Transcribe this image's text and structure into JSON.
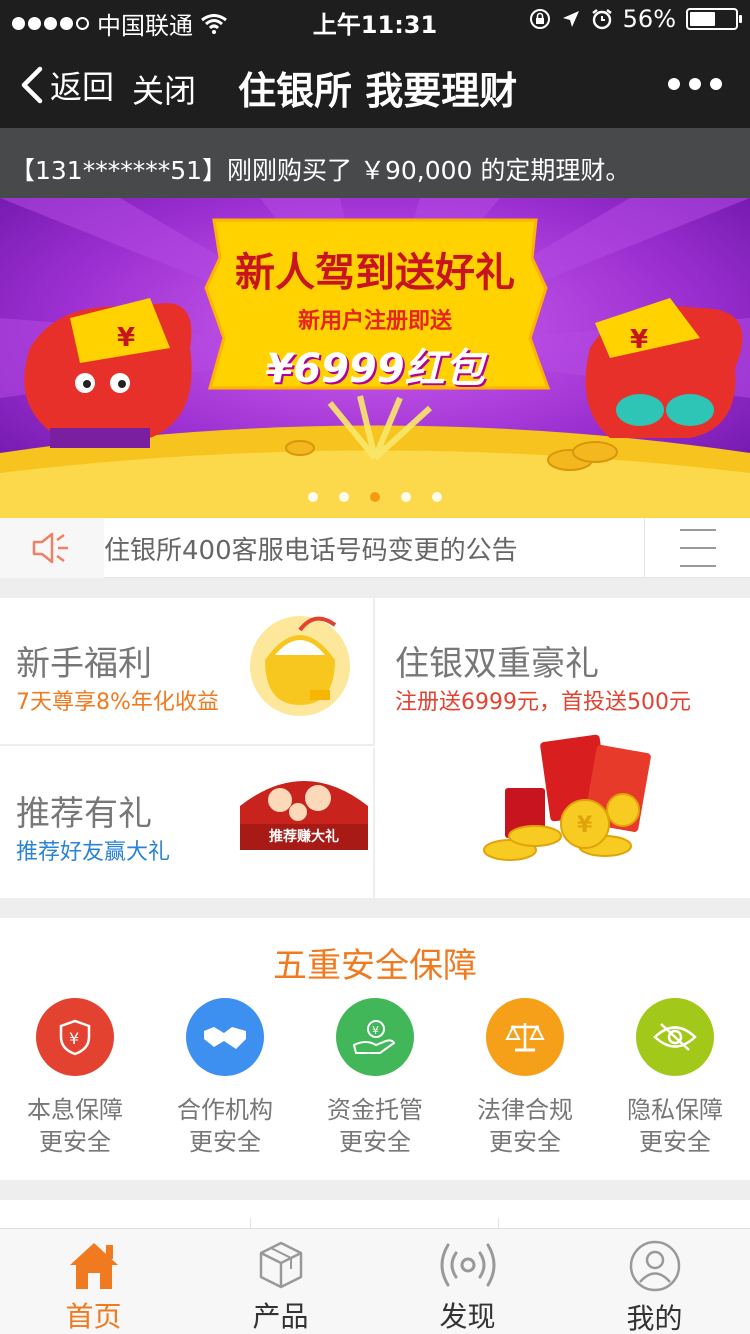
{
  "status_bar": {
    "carrier": "中国联通",
    "time": "上午11:31",
    "battery": "56%",
    "battery_level": 0.56
  },
  "nav": {
    "back_label": "返回",
    "close_label": "关闭",
    "title": "住银所 我要理财"
  },
  "ticker": {
    "text": "【131*******51】刚刚购买了 ￥90,000 的定期理财。"
  },
  "banner": {
    "headline": "新人驾到送好礼",
    "subline": "新用户注册即送",
    "amount": "¥6999红包",
    "page_count": 5,
    "active_index": 2
  },
  "notice": {
    "text": "住银所400客服电话号码变更的公告"
  },
  "promos": {
    "newbie": {
      "title": "新手福利",
      "subtitle": "7天尊享8%年化收益"
    },
    "refer": {
      "title": "推荐有礼",
      "subtitle": "推荐好友赢大礼",
      "badge": "推荐赚大礼"
    },
    "double": {
      "title": "住银双重豪礼",
      "subtitle": "注册送6999元，首投送500元"
    }
  },
  "safety": {
    "title": "五重安全保障",
    "features": [
      {
        "name": "本息保障",
        "sub": "更安全",
        "icon": "shield-yen-icon",
        "color": "#e2422f"
      },
      {
        "name": "合作机构",
        "sub": "更安全",
        "icon": "handshake-icon",
        "color": "#3d8ff0"
      },
      {
        "name": "资金托管",
        "sub": "更安全",
        "icon": "hand-coin-icon",
        "color": "#42b75a"
      },
      {
        "name": "法律合规",
        "sub": "更安全",
        "icon": "scale-icon",
        "color": "#f6a01a"
      },
      {
        "name": "隐私保障",
        "sub": "更安全",
        "icon": "eye-slash-icon",
        "color": "#a2c81a"
      }
    ]
  },
  "tabs": [
    {
      "label": "首页",
      "icon": "home-icon",
      "active": true
    },
    {
      "label": "产品",
      "icon": "box-icon",
      "active": false
    },
    {
      "label": "发现",
      "icon": "broadcast-icon",
      "active": false
    },
    {
      "label": "我的",
      "icon": "user-icon",
      "active": false
    }
  ],
  "colors": {
    "accent": "#f07a1f",
    "nav_bg": "#1e1e1e",
    "ticker_bg": "#48494b",
    "newbie_sub": "#f07a1f",
    "refer_sub": "#2a83d6",
    "double_sub": "#e2422f"
  }
}
